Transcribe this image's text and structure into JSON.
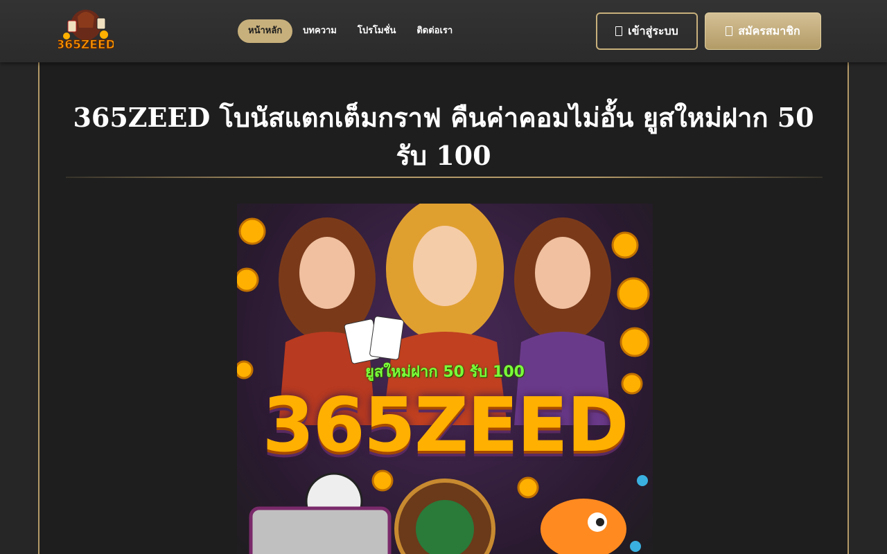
{
  "header": {
    "logo_text": "365ZEED",
    "nav": [
      {
        "label": "หน้าหลัก",
        "active": true
      },
      {
        "label": "บทความ",
        "active": false
      },
      {
        "label": "โปรโมชั่น",
        "active": false
      },
      {
        "label": "ติดต่อเรา",
        "active": false
      }
    ],
    "login_label": "เข้าสู่ระบบ",
    "register_label": "สมัครสมาชิก"
  },
  "main": {
    "title": "365ZEED โบนัสแตกเต็มกราฟ คืนค่าคอมไม่อั้น ยูสใหม่ฝาก 50 รับ 100",
    "banner": {
      "tagline": "ยูสใหม่ฝาก 50 รับ 100",
      "brand": "365ZEED"
    }
  },
  "colors": {
    "accent_gold": "#c8b07c",
    "header_bg": "#2e2e2e",
    "main_bg": "#1e1e1e",
    "body_bg": "#262626"
  },
  "icons": {
    "login_button": "login-icon",
    "register_button": "user-plus-icon"
  }
}
